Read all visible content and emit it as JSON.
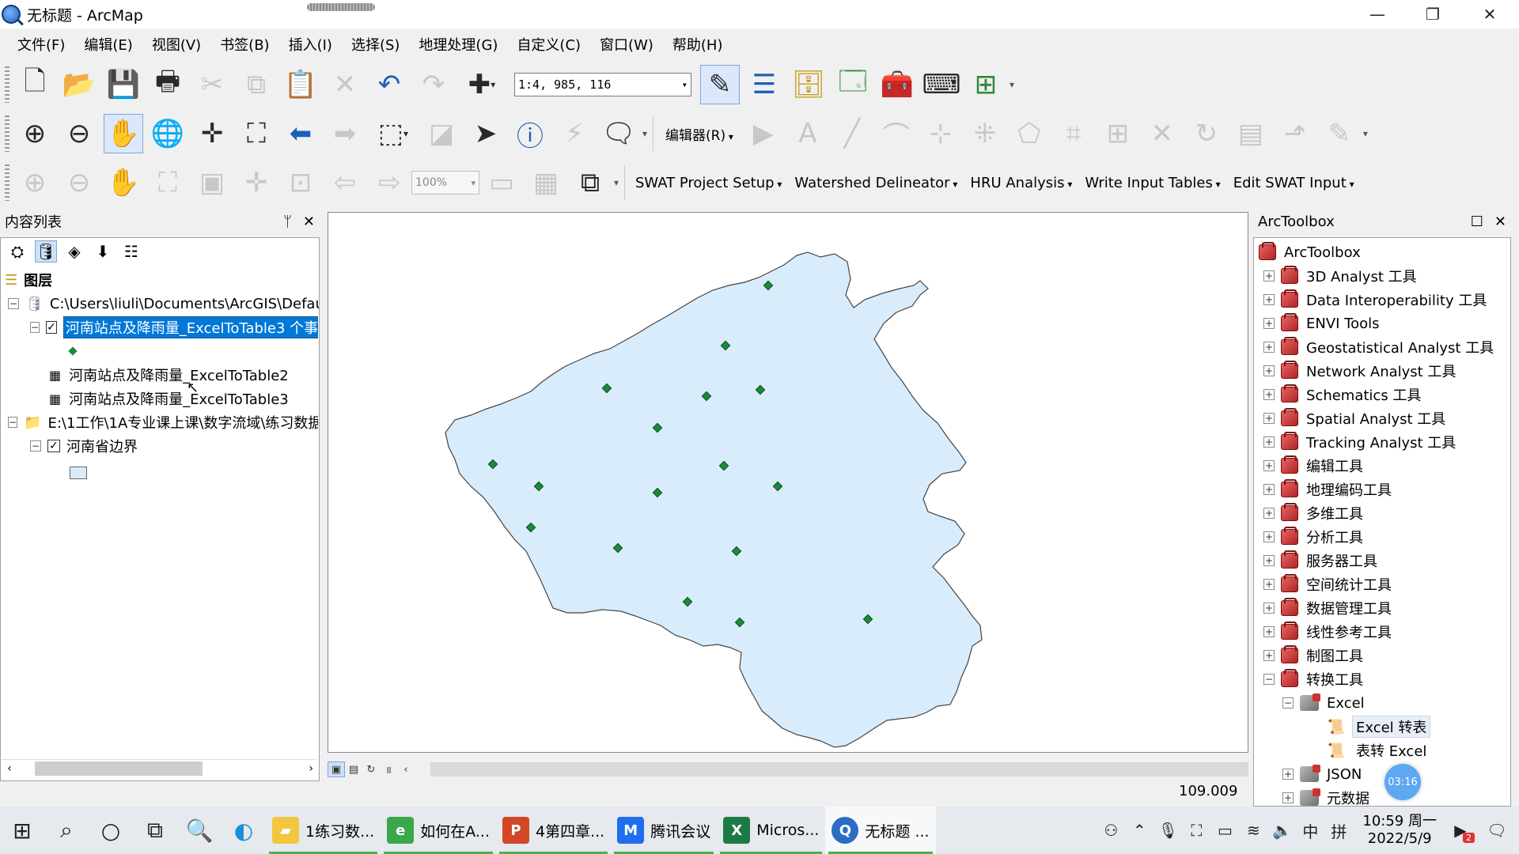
{
  "window": {
    "title": "无标题 - ArcMap",
    "minimize": "—",
    "restore": "❐",
    "close": "✕"
  },
  "menu": [
    "文件(F)",
    "编辑(E)",
    "视图(V)",
    "书签(B)",
    "插入(I)",
    "选择(S)",
    "地理处理(G)",
    "自定义(C)",
    "窗口(W)",
    "帮助(H)"
  ],
  "toolbar": {
    "scale": "1:4, 985, 116",
    "editor_menu": "编辑器(R)",
    "zoom_percent": "100%",
    "swat_menus": [
      "SWAT Project Setup",
      "Watershed Delineator",
      "HRU Analysis",
      "Write Input Tables",
      "Edit SWAT Input"
    ]
  },
  "toc": {
    "title": "内容列表",
    "pin": "ᛘ",
    "close": "✕",
    "root": "图层",
    "folder1": "C:\\Users\\liuli\\Documents\\ArcGIS\\Defau",
    "layer_selected": "河南站点及降雨量_ExcelToTable3 个事",
    "table2": "河南站点及降雨量_ExcelToTable2",
    "table3": "河南站点及降雨量_ExcelToTable3",
    "folder2": "E:\\1工作\\1A专业课上课\\数字流域\\练习数据",
    "boundary_layer": "河南省边界"
  },
  "map": {
    "fill_color": "#d9ecfb",
    "point_color": "#1b8a3a",
    "coordinate_readout": "109.009"
  },
  "toolbox": {
    "title": "ArcToolbox",
    "root": "ArcToolbox",
    "items": [
      "3D Analyst 工具",
      "Data Interoperability 工具",
      "ENVI Tools",
      "Geostatistical Analyst 工具",
      "Network Analyst 工具",
      "Schematics 工具",
      "Spatial Analyst 工具",
      "Tracking Analyst 工具",
      "编辑工具",
      "地理编码工具",
      "多维工具",
      "分析工具",
      "服务器工具",
      "空间统计工具",
      "数据管理工具",
      "线性参考工具",
      "制图工具",
      "转换工具"
    ],
    "excel_set": "Excel",
    "excel_tools": [
      "Excel 转表",
      "表转 Excel"
    ],
    "json_set": "JSON",
    "meta_set": "元数据"
  },
  "timer": "03:16",
  "taskbar": {
    "apps": [
      "1练习数...",
      "如何在A...",
      "4第四章...",
      "腾讯会议",
      "Micros...",
      "无标题 ..."
    ],
    "ime": "中",
    "ime2": "拼",
    "time": "10:59 周一",
    "date": "2022/5/9",
    "badge": "2"
  }
}
